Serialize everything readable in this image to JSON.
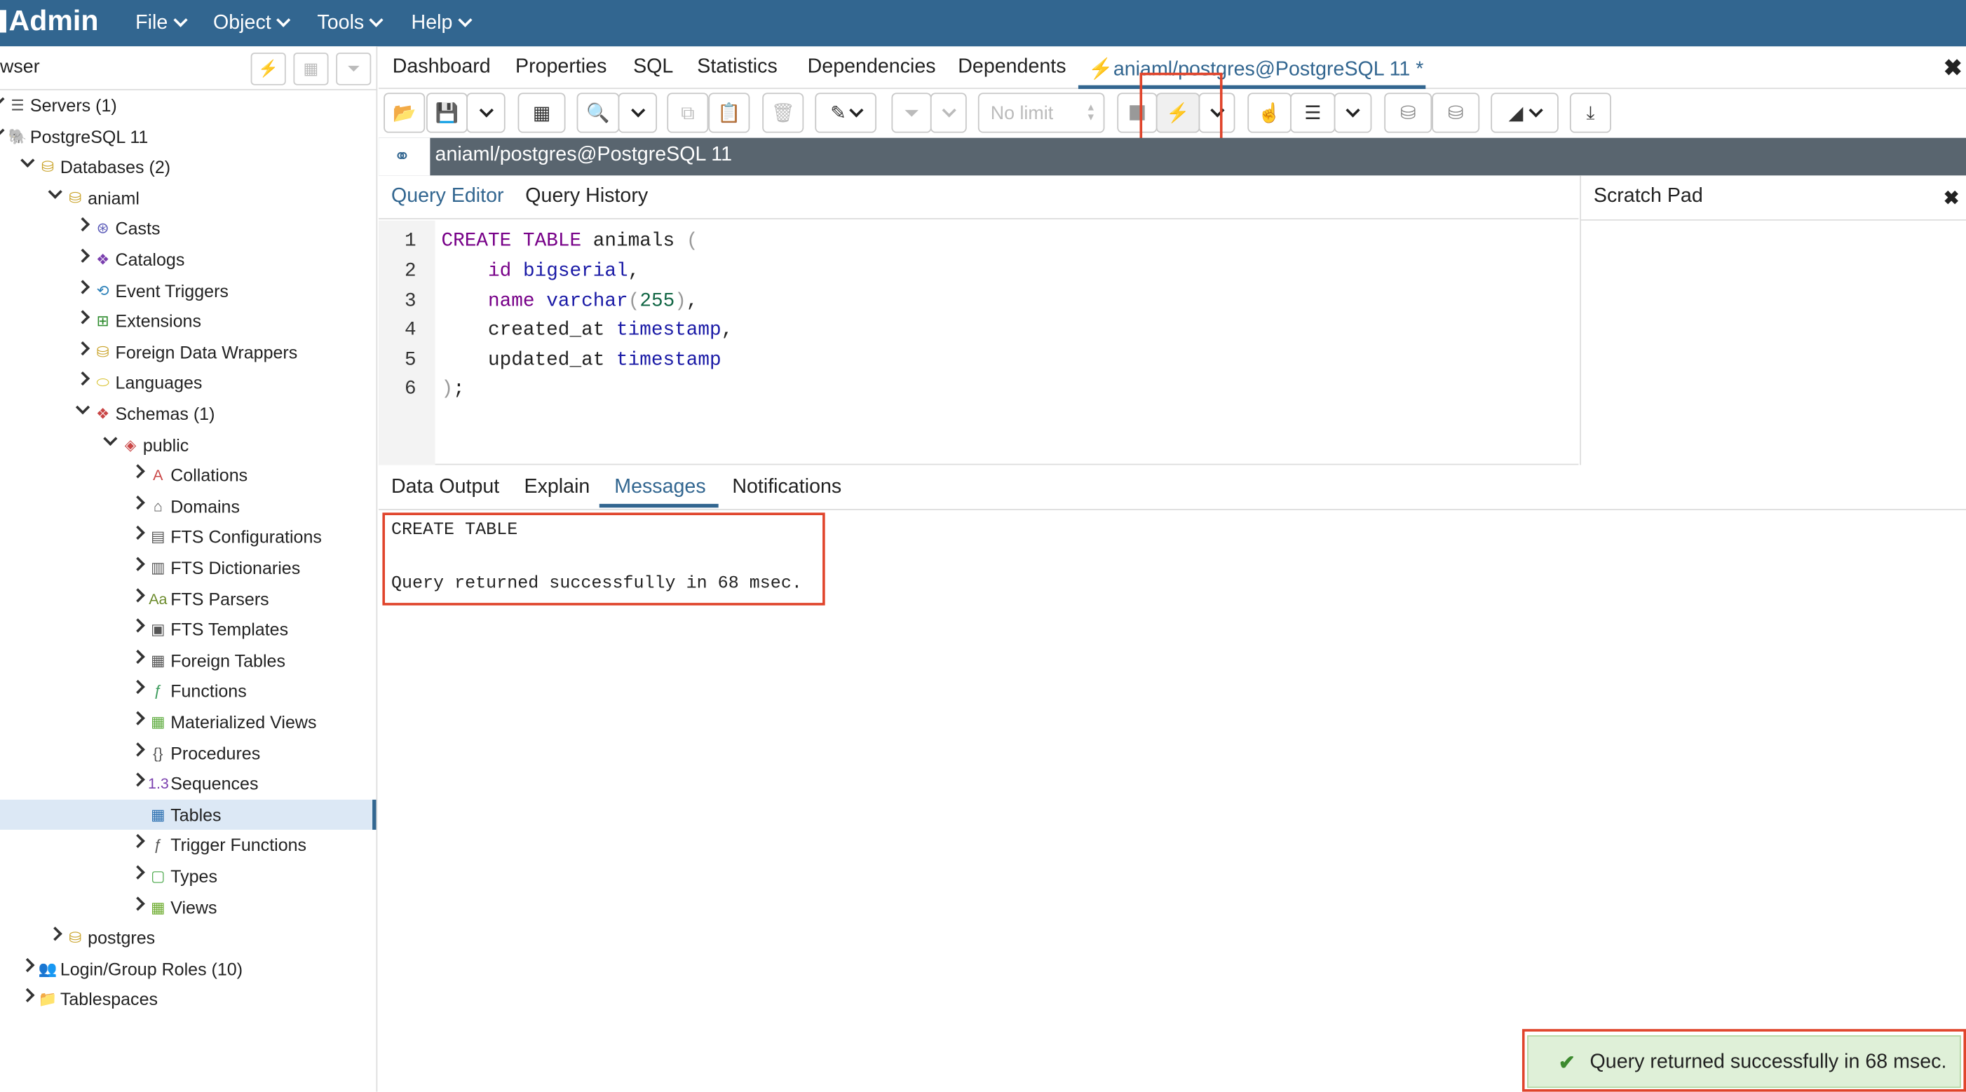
{
  "app": {
    "logo": "Admin"
  },
  "menubar": {
    "items": [
      "File",
      "Object",
      "Tools",
      "Help"
    ]
  },
  "browser": {
    "title": "wser",
    "tree": [
      {
        "label": "Servers (1)",
        "icon": "servers-icon",
        "twisty": "down"
      },
      {
        "label": "PostgreSQL 11",
        "icon": "elephant-icon",
        "twisty": "down"
      },
      {
        "label": "Databases (2)",
        "icon": "database-icon",
        "twisty": "down"
      },
      {
        "label": "aniaml",
        "icon": "database-icon",
        "twisty": "down"
      },
      {
        "label": "Casts",
        "icon": "casts-icon",
        "twisty": "right"
      },
      {
        "label": "Catalogs",
        "icon": "catalogs-icon",
        "twisty": "right"
      },
      {
        "label": "Event Triggers",
        "icon": "event-trigger-icon",
        "twisty": "right"
      },
      {
        "label": "Extensions",
        "icon": "extensions-icon",
        "twisty": "right"
      },
      {
        "label": "Foreign Data Wrappers",
        "icon": "fdw-icon",
        "twisty": "right"
      },
      {
        "label": "Languages",
        "icon": "languages-icon",
        "twisty": "right"
      },
      {
        "label": "Schemas (1)",
        "icon": "schemas-icon",
        "twisty": "down"
      },
      {
        "label": "public",
        "icon": "schema-icon",
        "twisty": "down"
      },
      {
        "label": "Collations",
        "icon": "collations-icon",
        "twisty": "right"
      },
      {
        "label": "Domains",
        "icon": "domains-icon",
        "twisty": "right"
      },
      {
        "label": "FTS Configurations",
        "icon": "fts-config-icon",
        "twisty": "right"
      },
      {
        "label": "FTS Dictionaries",
        "icon": "fts-dict-icon",
        "twisty": "right"
      },
      {
        "label": "FTS Parsers",
        "icon": "fts-parser-icon",
        "twisty": "right"
      },
      {
        "label": "FTS Templates",
        "icon": "fts-template-icon",
        "twisty": "right"
      },
      {
        "label": "Foreign Tables",
        "icon": "foreign-table-icon",
        "twisty": "right"
      },
      {
        "label": "Functions",
        "icon": "functions-icon",
        "twisty": "right"
      },
      {
        "label": "Materialized Views",
        "icon": "mview-icon",
        "twisty": "right"
      },
      {
        "label": "Procedures",
        "icon": "procedures-icon",
        "twisty": "right"
      },
      {
        "label": "Sequences",
        "icon": "sequences-icon",
        "twisty": "right"
      },
      {
        "label": "Tables",
        "icon": "tables-icon",
        "twisty": "none",
        "selected": true
      },
      {
        "label": "Trigger Functions",
        "icon": "trigger-fn-icon",
        "twisty": "right"
      },
      {
        "label": "Types",
        "icon": "types-icon",
        "twisty": "right"
      },
      {
        "label": "Views",
        "icon": "views-icon",
        "twisty": "right"
      },
      {
        "label": "postgres",
        "icon": "database-icon",
        "twisty": "right"
      },
      {
        "label": "Login/Group Roles (10)",
        "icon": "roles-icon",
        "twisty": "right"
      },
      {
        "label": "Tablespaces",
        "icon": "tablespaces-icon",
        "twisty": "right"
      }
    ]
  },
  "tabs": {
    "items": [
      "Dashboard",
      "Properties",
      "SQL",
      "Statistics",
      "Dependencies",
      "Dependents"
    ],
    "active": "aniaml/postgres@PostgreSQL 11 *"
  },
  "toolbar": {
    "limit_value": "No limit"
  },
  "connection": {
    "label": "aniaml/postgres@PostgreSQL 11"
  },
  "editor_tabs": {
    "query_editor": "Query Editor",
    "query_history": "Query History",
    "scratch_pad": "Scratch Pad"
  },
  "editor": {
    "line_numbers": [
      "1",
      "2",
      "3",
      "4",
      "5",
      "6"
    ]
  },
  "result_tabs": [
    "Data Output",
    "Explain",
    "Messages",
    "Notifications"
  ],
  "messages": {
    "line1": "CREATE TABLE",
    "line2": "Query returned successfully in 68 msec."
  },
  "toast": {
    "text": "Query returned successfully in 68 msec."
  },
  "colors": {
    "header": "#326690",
    "accent": "#326690",
    "highlight": "#e0442b",
    "success_bg": "#dff0d8"
  }
}
